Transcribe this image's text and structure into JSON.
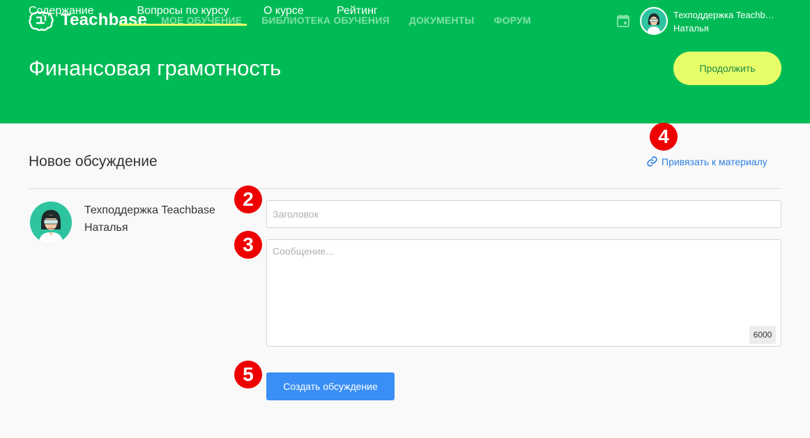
{
  "header": {
    "brand": "Teachbase",
    "nav": [
      "МОЕ ОБУЧЕНИЕ",
      "БИБЛИОТЕКА ОБУЧЕНИЯ",
      "ДОКУМЕНТЫ",
      "ФОРУМ"
    ],
    "user_line1": "Техподдержка Teachbase",
    "user_line2": "Наталья",
    "icons": {
      "logo": "brain-logo-icon",
      "calendar": "calendar-icon",
      "avatar": "user-avatar"
    }
  },
  "course": {
    "title": "Финансовая грамотность",
    "continue_label": "Продолжить"
  },
  "tabs": [
    {
      "label": "Содержание",
      "active": false
    },
    {
      "label": "Вопросы по курсу",
      "active": true
    },
    {
      "label": "О курсе",
      "active": false
    },
    {
      "label": "Рейтинг",
      "active": false
    }
  ],
  "discussion": {
    "title": "Новое обсуждение",
    "attach_label": "Привязать к материалу",
    "author_line1": "Техподдержка Teachbase",
    "author_line2": "Наталья",
    "title_placeholder": "Заголовок",
    "message_placeholder": "Сообщение...",
    "char_limit": "6000",
    "submit_label": "Создать обсуждение"
  },
  "markers": [
    "4",
    "2",
    "3",
    "5"
  ],
  "colors": {
    "brand_green": "#00bb55",
    "accent_yellow": "#e6fd68",
    "link_blue": "#2d7fe0",
    "button_blue": "#3a8ef6",
    "marker_red": "#ee0000"
  }
}
